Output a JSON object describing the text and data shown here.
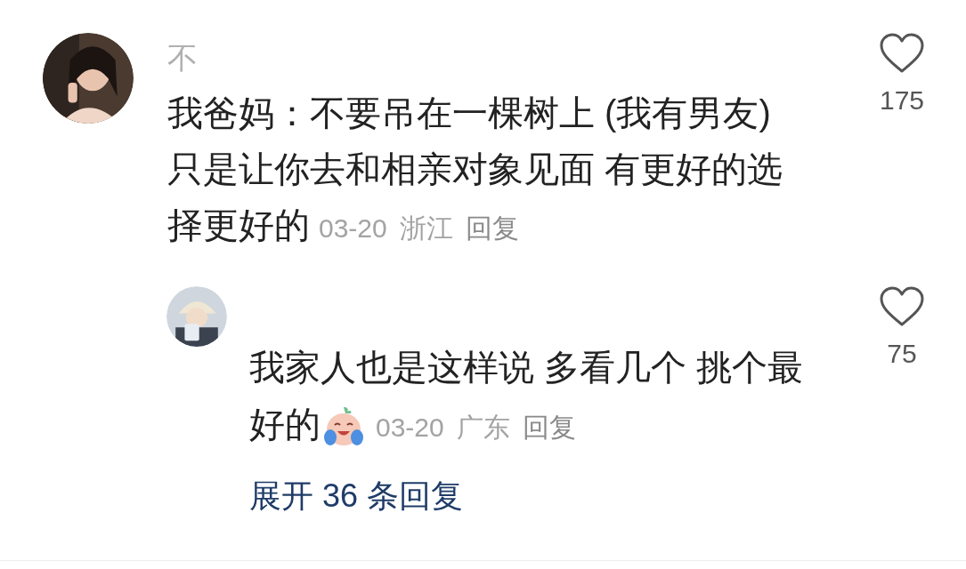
{
  "comments": [
    {
      "username": "不",
      "text": "我爸妈：不要吊在一棵树上 (我有男友) 只是让你去和相亲对象见面 有更好的选择更好的",
      "date": "03-20",
      "location": "浙江",
      "reply_label": "回复",
      "likes": "175",
      "liked": false,
      "replies": [
        {
          "text": "我家人也是这样说 多看几个 挑个最好的",
          "has_sticker": true,
          "date": "03-20",
          "location": "广东",
          "reply_label": "回复",
          "likes": "75",
          "liked": false
        }
      ],
      "expand_label": "展开 36 条回复"
    }
  ]
}
